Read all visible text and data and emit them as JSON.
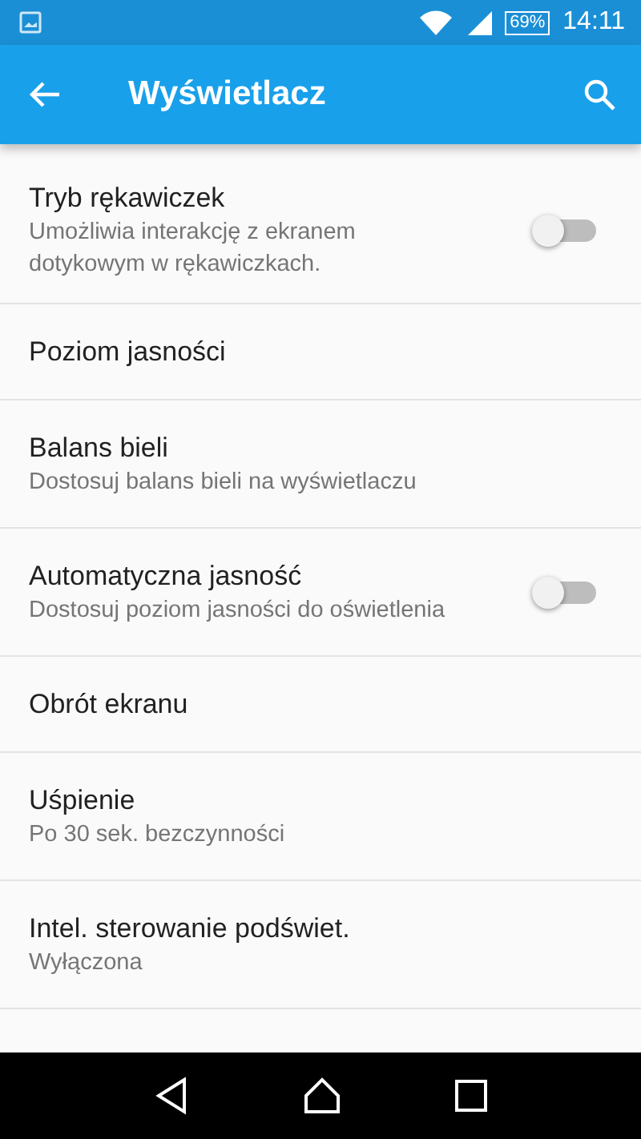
{
  "status_bar": {
    "battery": "69%",
    "time": "14:11"
  },
  "toolbar": {
    "title": "Wyświetlacz"
  },
  "settings": [
    {
      "kind": "switch",
      "title": "Tryb rękawiczek",
      "subtitle": "Umożliwia interakcję z ekranem dotykowym w rękawiczkach.",
      "on": false
    },
    {
      "kind": "plain",
      "title": "Poziom jasności"
    },
    {
      "kind": "plain",
      "title": "Balans bieli",
      "subtitle": "Dostosuj balans bieli na wyświetlaczu"
    },
    {
      "kind": "switch",
      "title": "Automatyczna jasność",
      "subtitle": "Dostosuj poziom jasności do oświetlenia",
      "on": false
    },
    {
      "kind": "plain",
      "title": "Obrót ekranu"
    },
    {
      "kind": "plain",
      "title": "Uśpienie",
      "subtitle": "Po 30 sek. bezczynności"
    },
    {
      "kind": "plain",
      "title": "Intel. sterowanie podświet.",
      "subtitle": "Wyłączona"
    }
  ]
}
